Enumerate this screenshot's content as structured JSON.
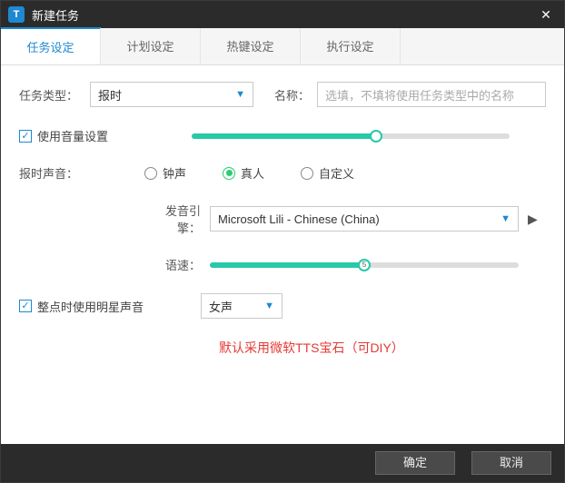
{
  "window": {
    "title": "新建任务"
  },
  "tabs": [
    "任务设定",
    "计划设定",
    "热键设定",
    "执行设定"
  ],
  "form": {
    "taskTypeLabel": "任务类型：",
    "taskTypeValue": "报时",
    "nameLabel": "名称：",
    "namePlaceholder": "选填，不填将使用任务类型中的名称",
    "useVolumeLabel": "使用音量设置",
    "soundLabel": "报时声音：",
    "radios": {
      "bell": "钟声",
      "human": "真人",
      "custom": "自定义"
    },
    "engineLabel": "发音引擎：",
    "engineValue": "Microsoft Lili - Chinese (China)",
    "speedLabel": "语速：",
    "hourStarLabel": "整点时使用明星声音",
    "voiceGenderValue": "女声",
    "note": "默认采用微软TTS宝石（可DIY）",
    "volumeSliderPct": 58,
    "speedSliderPct": 50,
    "speedMarker": "5"
  },
  "footer": {
    "ok": "确定",
    "cancel": "取消"
  }
}
